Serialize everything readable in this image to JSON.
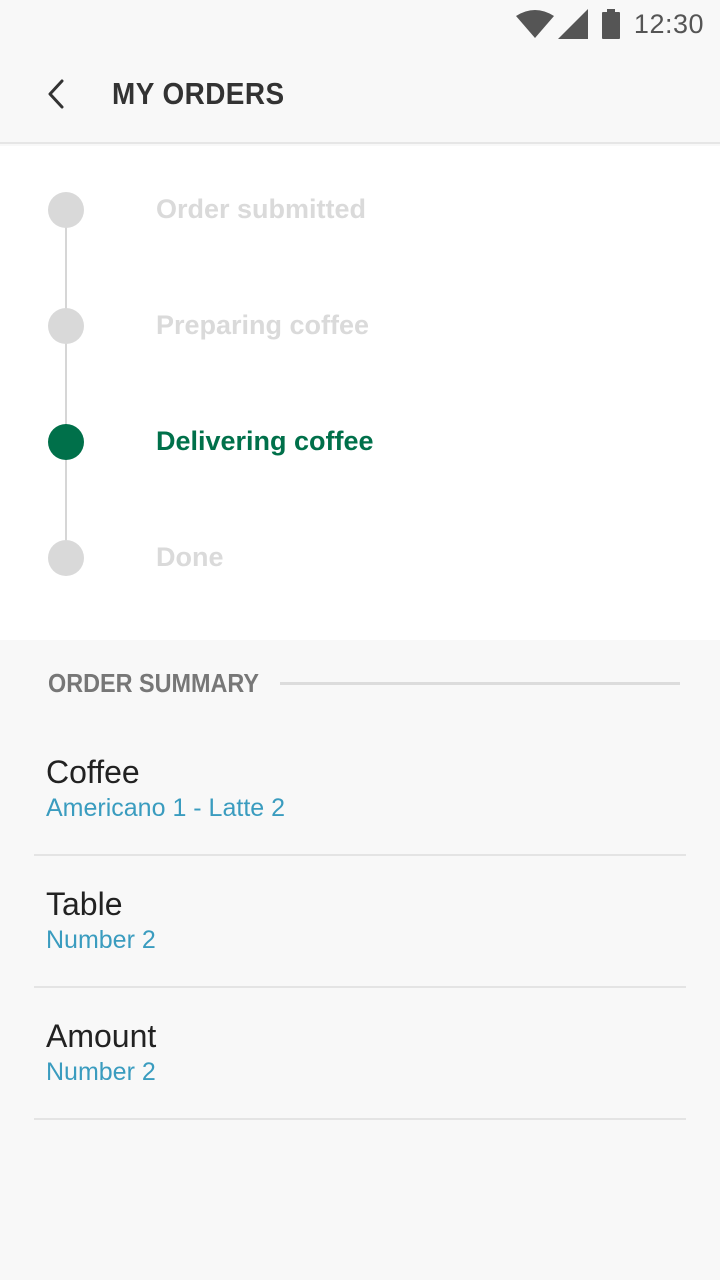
{
  "status_bar": {
    "time": "12:30",
    "icons": [
      "wifi-icon",
      "cell-signal-icon",
      "battery-icon"
    ]
  },
  "app_bar": {
    "back_icon": "chevron-left-icon",
    "title": "MY ORDERS"
  },
  "progress": {
    "steps": [
      {
        "label": "Order submitted",
        "state": "inactive"
      },
      {
        "label": "Preparing coffee",
        "state": "inactive"
      },
      {
        "label": "Delivering coffee",
        "state": "active"
      },
      {
        "label": "Done",
        "state": "inactive"
      }
    ],
    "active_color": "#00704a",
    "inactive_color": "#d9d9d9"
  },
  "summary": {
    "title": "ORDER SUMMARY",
    "items": [
      {
        "title": "Coffee",
        "value": "Americano 1 - Latte 2"
      },
      {
        "title": "Table",
        "value": "Number 2"
      },
      {
        "title": "Amount",
        "value": "Number 2"
      }
    ],
    "value_color": "#3a9cbf"
  }
}
